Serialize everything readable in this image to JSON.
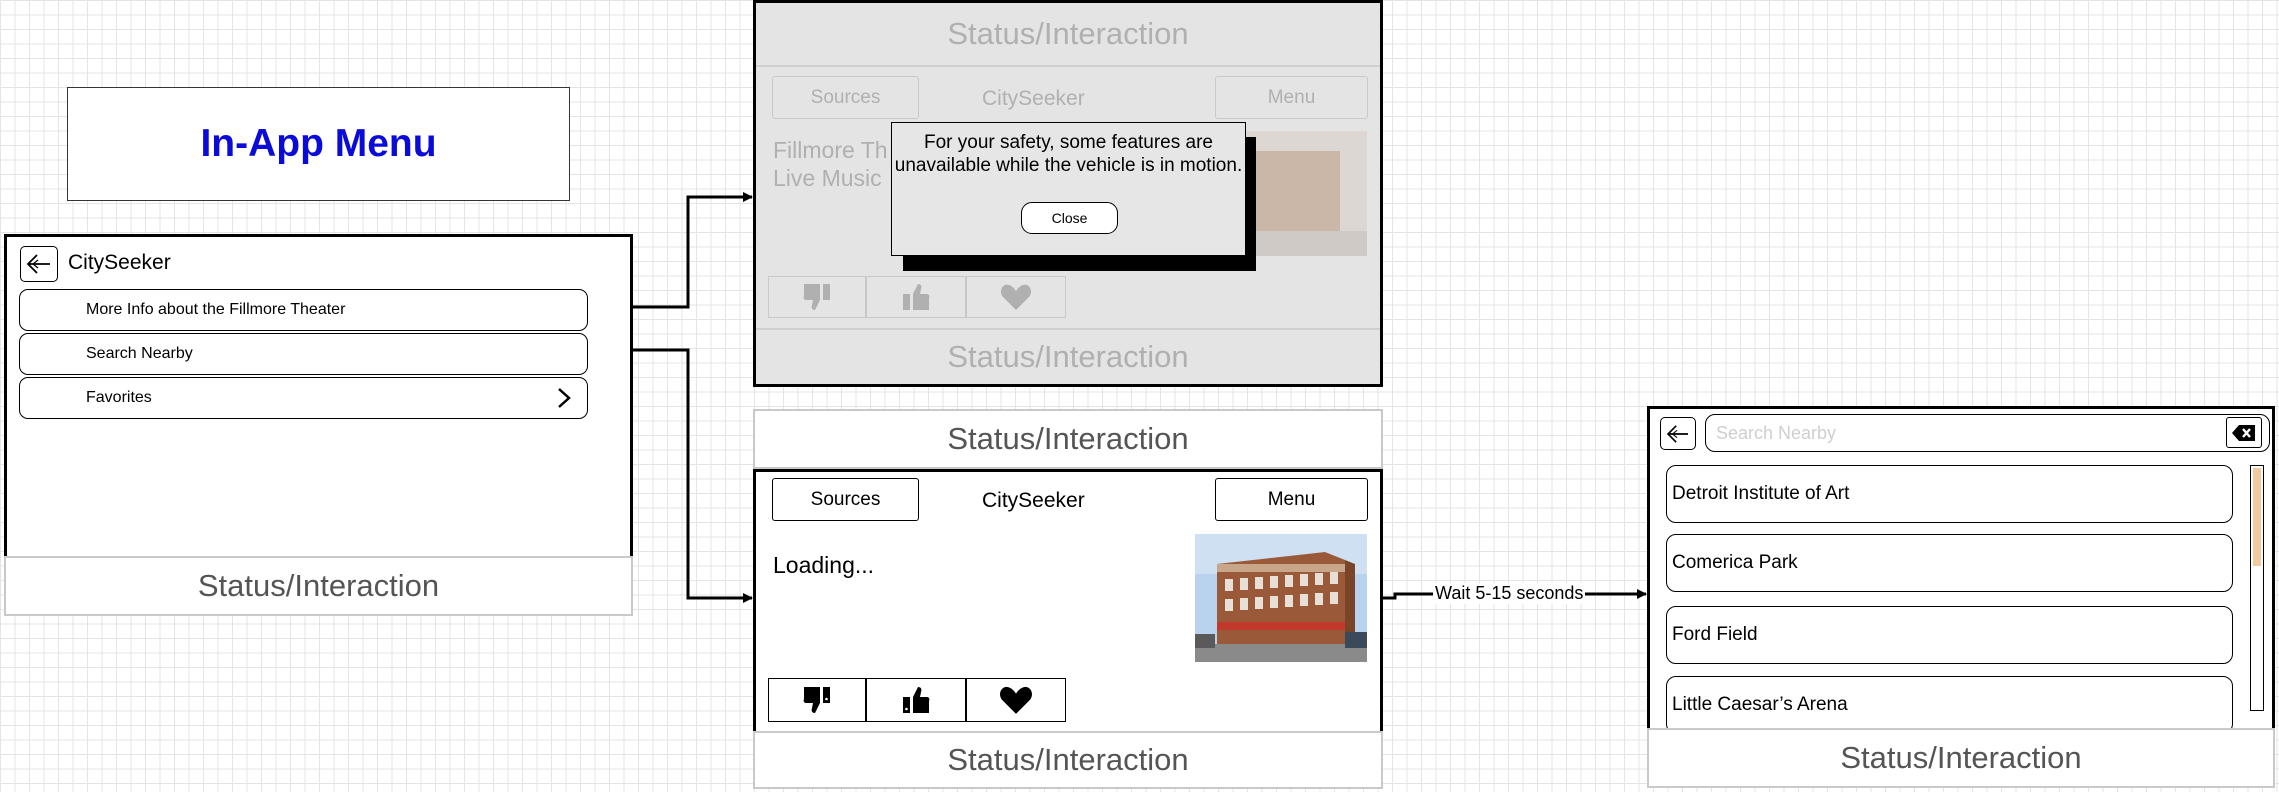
{
  "title": "In-App Menu",
  "colors": {
    "title": "#0b0bd9",
    "status_text": "#555555",
    "faded_text": "#b0b0b0",
    "scroll_thumb": "#f4c9a0"
  },
  "screen1": {
    "app_title": "CitySeeker",
    "back_icon": "back-arrow-icon",
    "menu_items": [
      {
        "label": "More Info about the Fillmore Theater"
      },
      {
        "label": "Search Nearby"
      },
      {
        "label": "Favorites",
        "icon": "chevron-right-icon"
      }
    ],
    "status": "Status/Interaction"
  },
  "screen2": {
    "status_top": "Status/Interaction",
    "sources_label": "Sources",
    "app_title": "CitySeeker",
    "menu_label": "Menu",
    "venue_line1": "Fillmore Th",
    "venue_line2": "Live Music",
    "popup": {
      "message_line1": "For your safety, some features are",
      "message_line2": "unavailable while the vehicle is in motion.",
      "close_label": "Close"
    },
    "status_bottom": "Status/Interaction"
  },
  "screen3": {
    "status_top": "Status/Interaction",
    "sources_label": "Sources",
    "app_title": "CitySeeker",
    "menu_label": "Menu",
    "loading_text": "Loading...",
    "rating_icons": [
      "thumbs-down-icon",
      "thumbs-up-icon",
      "heart-icon"
    ],
    "status_bottom": "Status/Interaction"
  },
  "connector": {
    "wait_label": "Wait 5-15 seconds"
  },
  "screen4": {
    "search_placeholder": "Search Nearby",
    "clear_icon": "backspace-icon",
    "results": [
      {
        "label": "Detroit Institute of Art"
      },
      {
        "label": "Comerica Park"
      },
      {
        "label": "Ford Field"
      },
      {
        "label": "Little Caesar’s Arena"
      }
    ],
    "status": "Status/Interaction"
  }
}
